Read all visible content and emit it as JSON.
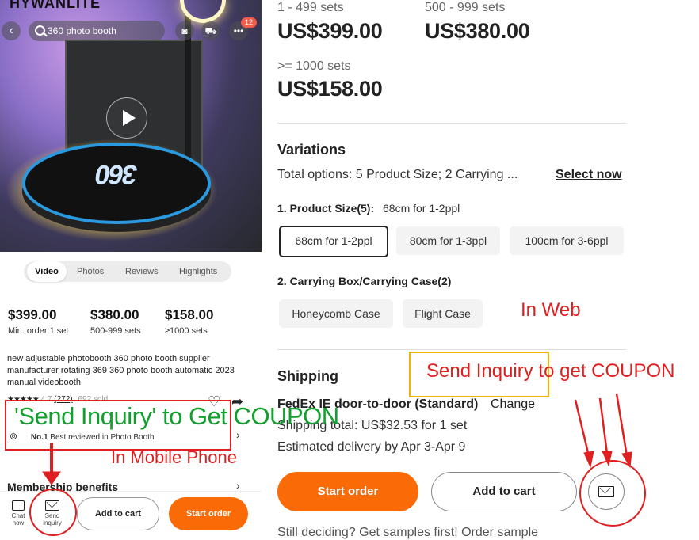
{
  "mobile": {
    "brand": "HYWANLITE",
    "search_query": "360 photo booth",
    "notification_count": "12",
    "media_tabs": [
      "Video",
      "Photos",
      "Reviews",
      "Highlights"
    ],
    "prices": [
      {
        "price": "$399.00",
        "note": "Min. order:1 set"
      },
      {
        "price": "$380.00",
        "note": "500-999 sets"
      },
      {
        "price": "$158.00",
        "note": "≥1000 sets"
      }
    ],
    "description": "new adjustable photobooth 360 photo booth supplier manufacturer rotating 369 360 photo booth automatic 2023 manual videobooth",
    "rating": "4.7",
    "review_count": "(272)",
    "sold": "692 sold",
    "best_rank": "No.1",
    "best_text": "Best reviewed in Photo Booth",
    "membership": "Membership benefits",
    "bottom": {
      "chat_label": "Chat now",
      "inquiry_label": "Send inquiry",
      "add_to_cart": "Add to cart",
      "start_order": "Start order"
    }
  },
  "web": {
    "tiers": [
      {
        "range": "1 - 499 sets",
        "price": "US$399.00"
      },
      {
        "range": "500 - 999 sets",
        "price": "US$380.00"
      },
      {
        "range": ">= 1000 sets",
        "price": "US$158.00"
      }
    ],
    "variations_title": "Variations",
    "total_options": "Total options: 5 Product Size; 2 Carrying ...",
    "select_now": "Select now",
    "size_label": "1. Product Size(5):",
    "size_value": "68cm for 1-2ppl",
    "sizes": [
      "68cm for 1-2ppl",
      "80cm for 1-3ppl",
      "100cm for 3-6ppl"
    ],
    "case_label": "2. Carrying Box/Carrying Case(2)",
    "cases": [
      "Honeycomb Case",
      "Flight Case"
    ],
    "shipping_title": "Shipping",
    "shipping_method": "FedEx IE door-to-door (Standard)",
    "change": "Change",
    "shipping_total": "Shipping total: US$32.53 for 1 set",
    "delivery": "Estimated delivery by Apr 3-Apr 9",
    "start_order": "Start order",
    "add_to_cart": "Add to cart",
    "samples": "Still deciding? Get samples first! Order sample"
  },
  "annotations": {
    "mobile_headline": "'Send Inquiry' to Get COUPON",
    "mobile_caption": "In Mobile Phone",
    "web_caption": "In Web",
    "web_boxed": "Send Inquiry",
    "web_suffix": " to get COUPON"
  },
  "colors": {
    "accent": "#fa6a06",
    "annotation_red": "#e02020",
    "annotation_green": "#11a02d",
    "annotation_yellow": "#f0b400"
  }
}
